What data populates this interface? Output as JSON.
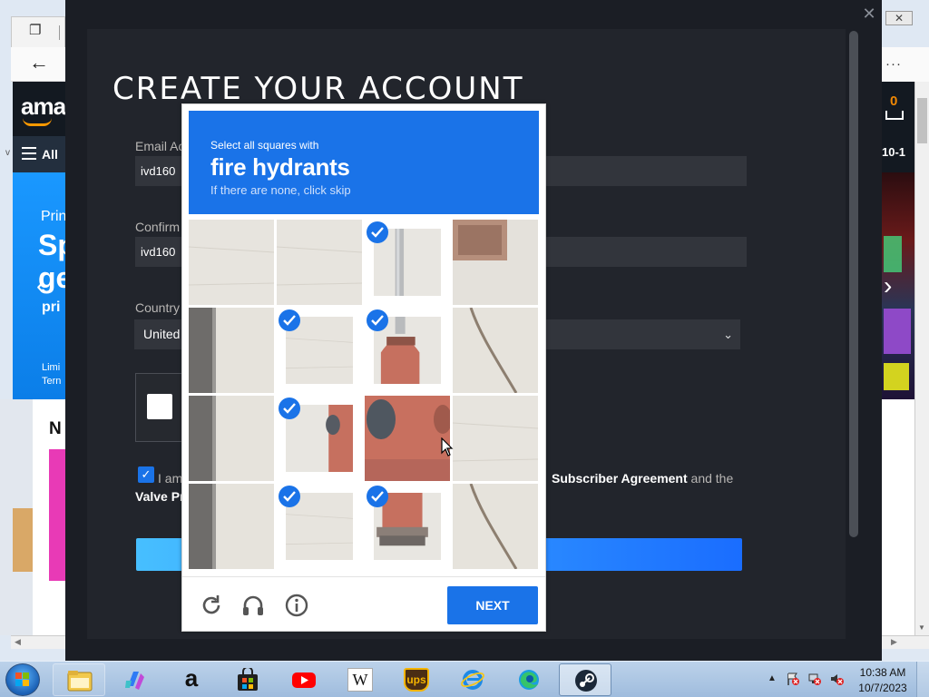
{
  "background_left": {
    "amazon_logo": "ama",
    "nav_all": "All",
    "v_text": "v",
    "hero_prime": "Prin",
    "hero_big": "Sp\nge",
    "hero_prime2": "pri",
    "hero_limit": "Limi\nTern",
    "card_text": "N"
  },
  "background_right": {
    "close_glyph": "✕",
    "more_glyph": "···",
    "cart_count": "0",
    "date_fragment": "10-1"
  },
  "dialog": {
    "title": "CREATE YOUR ACCOUNT",
    "email_label": "Email Ac",
    "email_value": "ivd160",
    "confirm_label": "Confirm",
    "confirm_value": "ivd160",
    "country_label": "Country",
    "country_value": "United",
    "agree_prefix": "I am",
    "agree_mid": "Subscriber Agreement",
    "agree_suffix": " and the",
    "agree_line2": "Valve Pr",
    "close_glyph": "✕"
  },
  "recaptcha": {
    "instruction": "Select all squares with",
    "target": "fire hydrants",
    "hint": "If there are none, click skip",
    "next_label": "NEXT",
    "tiles": [
      {
        "row": 0,
        "col": 0,
        "selected": false,
        "content": "pavement"
      },
      {
        "row": 0,
        "col": 1,
        "selected": false,
        "content": "pavement"
      },
      {
        "row": 0,
        "col": 2,
        "selected": true,
        "content": "hydrant-pipe"
      },
      {
        "row": 0,
        "col": 3,
        "selected": false,
        "content": "pavement-grate"
      },
      {
        "row": 1,
        "col": 0,
        "selected": false,
        "content": "pole"
      },
      {
        "row": 1,
        "col": 1,
        "selected": true,
        "content": "pavement"
      },
      {
        "row": 1,
        "col": 2,
        "selected": true,
        "content": "hydrant-top"
      },
      {
        "row": 1,
        "col": 3,
        "selected": false,
        "content": "pavement-crack"
      },
      {
        "row": 2,
        "col": 0,
        "selected": false,
        "content": "pole"
      },
      {
        "row": 2,
        "col": 1,
        "selected": true,
        "content": "hydrant-cap"
      },
      {
        "row": 2,
        "col": 2,
        "selected": false,
        "content": "hydrant-body"
      },
      {
        "row": 2,
        "col": 3,
        "selected": false,
        "content": "pavement"
      },
      {
        "row": 3,
        "col": 0,
        "selected": false,
        "content": "pole"
      },
      {
        "row": 3,
        "col": 1,
        "selected": true,
        "content": "pavement"
      },
      {
        "row": 3,
        "col": 2,
        "selected": true,
        "content": "hydrant-base"
      },
      {
        "row": 3,
        "col": 3,
        "selected": false,
        "content": "pavement-crack"
      }
    ],
    "icons": [
      "reload-icon",
      "headphones-icon",
      "info-icon"
    ]
  },
  "taskbar": {
    "apps": [
      "file-explorer",
      "copilot",
      "amazon",
      "microsoft-store",
      "youtube",
      "wikipedia",
      "ups",
      "internet-explorer",
      "edge",
      "steam"
    ],
    "wikipedia_glyph": "W",
    "ups_glyph": "ups",
    "amazon_glyph": "a",
    "time": "10:38 AM",
    "date": "10/7/2023"
  },
  "colors": {
    "recaptcha_blue": "#1a73e8",
    "steam_dark": "#1b1e25",
    "steam_button": "#47bfff"
  }
}
